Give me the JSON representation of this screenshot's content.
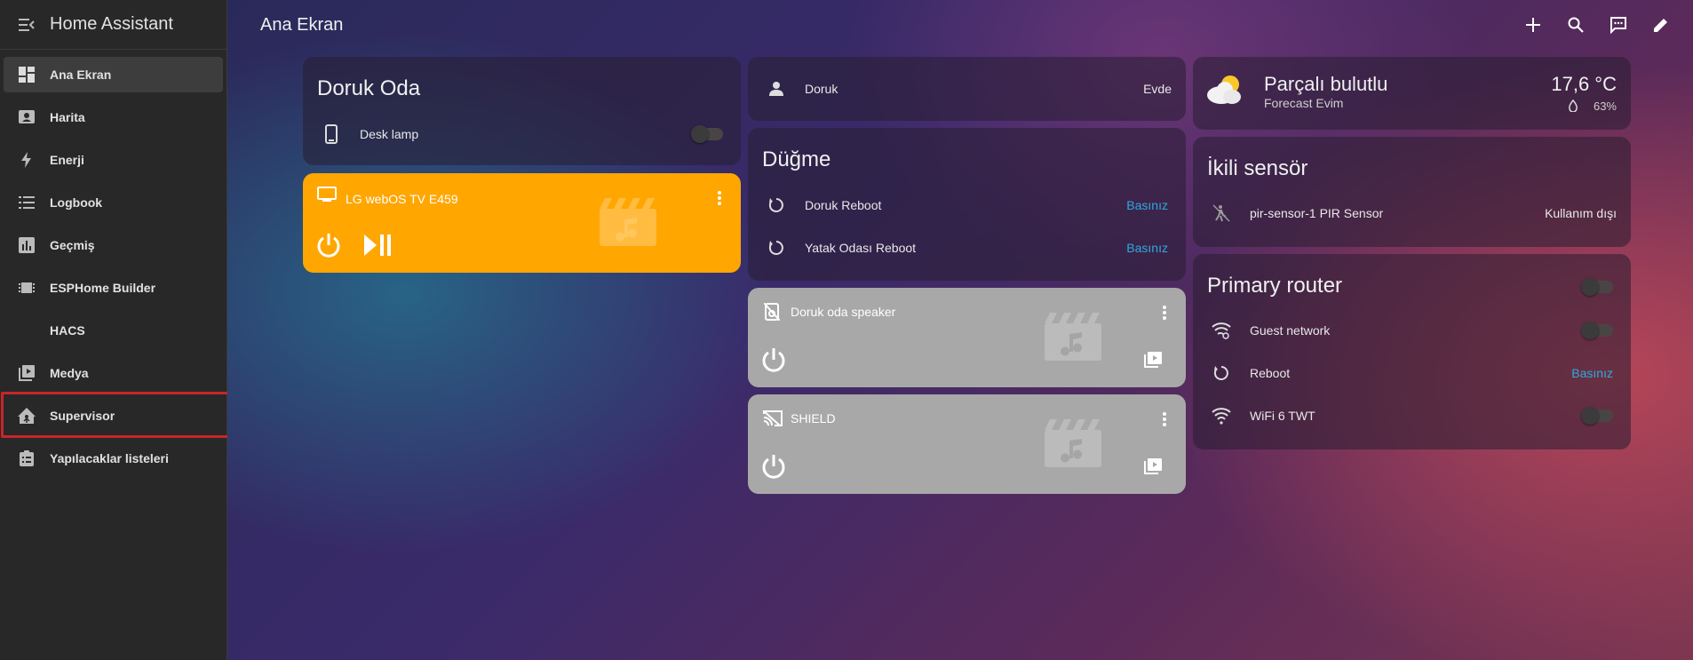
{
  "app": {
    "title": "Home Assistant"
  },
  "sidebar": {
    "items": [
      {
        "label": "Ana Ekran",
        "icon": "dashboard-icon",
        "active": true
      },
      {
        "label": "Harita",
        "icon": "map-icon"
      },
      {
        "label": "Enerji",
        "icon": "lightning-icon"
      },
      {
        "label": "Logbook",
        "icon": "list-icon"
      },
      {
        "label": "Geçmiş",
        "icon": "chart-icon"
      },
      {
        "label": "ESPHome Builder",
        "icon": "chip-icon"
      },
      {
        "label": "HACS",
        "icon": ""
      },
      {
        "label": "Medya",
        "icon": "media-play-icon"
      },
      {
        "label": "Supervisor",
        "icon": "home-assistant-icon"
      },
      {
        "label": "Yapılacaklar listeleri",
        "icon": "clipboard-list-icon"
      }
    ]
  },
  "header": {
    "title": "Ana Ekran"
  },
  "cards": {
    "doruk_oda": {
      "title": "Doruk Oda",
      "row_label": "Desk lamp"
    },
    "lg_tv": {
      "name": "LG webOS TV E459",
      "color": "#ffa600"
    },
    "person": {
      "name": "Doruk",
      "state": "Evde"
    },
    "dugme": {
      "title": "Düğme",
      "rows": [
        {
          "label": "Doruk Reboot",
          "action": "Basınız"
        },
        {
          "label": "Yatak Odası Reboot",
          "action": "Basınız"
        }
      ]
    },
    "speaker": {
      "name": "Doruk oda speaker"
    },
    "shield": {
      "name": "SHIELD"
    },
    "weather": {
      "condition": "Parçalı bulutlu",
      "location": "Forecast Evim",
      "temperature": "17,6 °C",
      "humidity": "63%"
    },
    "binary": {
      "title": "İkili sensör",
      "label": "pir-sensor-1 PIR Sensor",
      "state": "Kullanım dışı"
    },
    "router": {
      "title": "Primary router",
      "rows": [
        {
          "label": "Guest network",
          "type": "toggle"
        },
        {
          "label": "Reboot",
          "type": "button",
          "action": "Basınız"
        },
        {
          "label": "WiFi 6 TWT",
          "type": "toggle"
        }
      ]
    }
  },
  "colors": {
    "accent": "#2ea9e0",
    "media_active": "#ffa600",
    "media_off": "#a8a8a8",
    "highlight": "#c8252a"
  }
}
